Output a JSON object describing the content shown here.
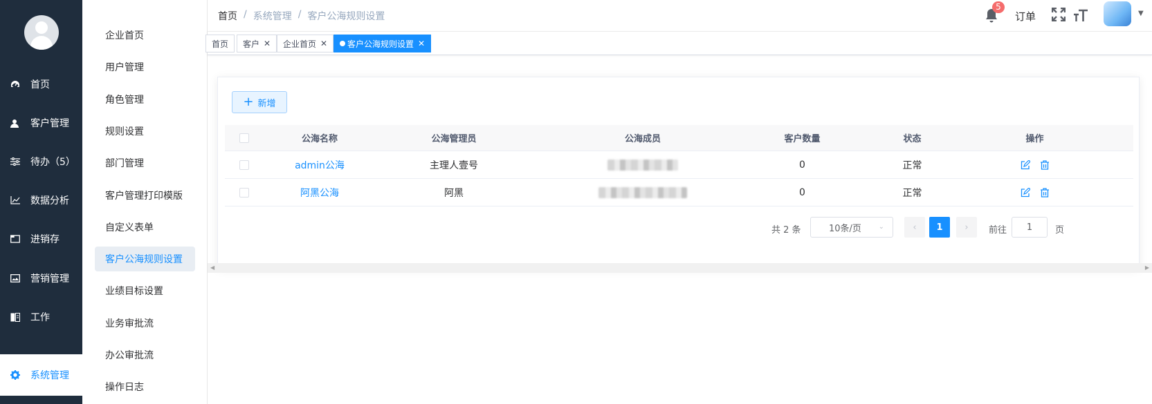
{
  "nav": {
    "items": [
      {
        "label": "首页",
        "icon": "dashboard-icon"
      },
      {
        "label": "客户管理",
        "icon": "user-icon"
      },
      {
        "label": "待办（5）",
        "icon": "sliders-icon"
      },
      {
        "label": "数据分析",
        "icon": "chart-icon"
      },
      {
        "label": "进销存",
        "icon": "folder-icon"
      },
      {
        "label": "营销管理",
        "icon": "picture-icon"
      },
      {
        "label": "工作",
        "icon": "book-icon"
      },
      {
        "label": "系统管理",
        "icon": "gear-icon"
      }
    ],
    "active_color": "#1890ff",
    "background": "#1f2d3d"
  },
  "submenu": {
    "items": [
      "企业首页",
      "用户管理",
      "角色管理",
      "规则设置",
      "部门管理",
      "客户管理打印模版",
      "自定义表单",
      "客户公海规则设置",
      "业绩目标设置",
      "业务审批流",
      "办公审批流",
      "操作日志"
    ],
    "active": "客户公海规则设置"
  },
  "header": {
    "breadcrumb": [
      "首页",
      "系统管理",
      "客户公海规则设置"
    ],
    "separator": "/",
    "notification_count": "5",
    "order_label": "订单"
  },
  "tags": [
    {
      "label": "首页",
      "closable": false
    },
    {
      "label": "客户",
      "closable": true
    },
    {
      "label": "企业首页",
      "closable": true
    },
    {
      "label": "客户公海规则设置",
      "closable": true,
      "active": true
    }
  ],
  "toolbar": {
    "add_label": "新增",
    "add_icon": "+"
  },
  "table": {
    "columns": [
      "公海名称",
      "公海管理员",
      "公海成员",
      "客户数量",
      "状态",
      "操作"
    ],
    "rows": [
      {
        "name": "admin公海",
        "admin": "主理人壹号",
        "members": "",
        "count": "0",
        "status": "正常"
      },
      {
        "name": "阿黑公海",
        "admin": "阿黑",
        "members": "",
        "count": "0",
        "status": "正常"
      }
    ]
  },
  "pagination": {
    "total_text": "共 2 条",
    "page_size": "10条/页",
    "current_page": "1",
    "goto_label": "前往",
    "goto_value": "1",
    "page_unit": "页"
  }
}
